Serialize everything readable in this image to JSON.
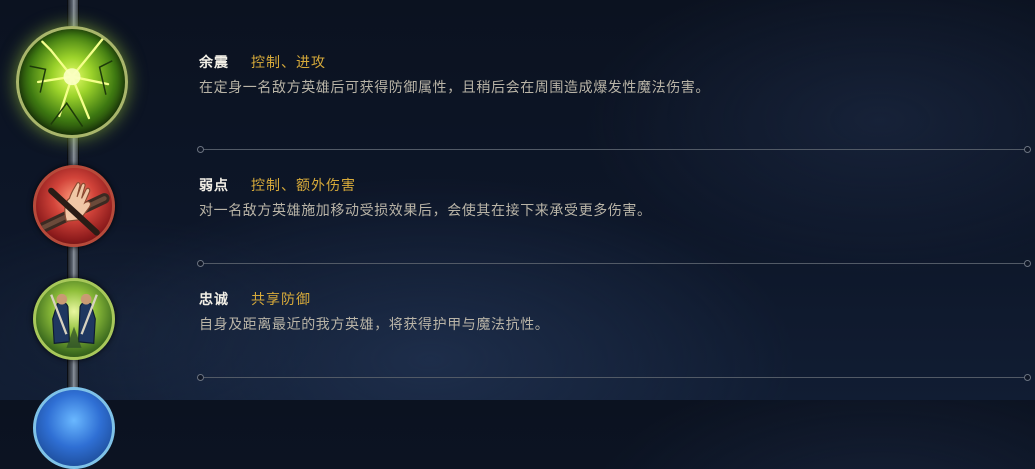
{
  "runes": [
    {
      "name": "余震",
      "tags": "控制、进攻",
      "description": "在定身一名敌方英雄后可获得防御属性，且稍后会在周围造成爆发性魔法伤害。",
      "icon": "aftershock-icon"
    },
    {
      "name": "弱点",
      "tags": "控制、额外伤害",
      "description": "对一名敌方英雄施加移动受损效果后，会使其在接下来承受更多伤害。",
      "icon": "weakness-icon"
    },
    {
      "name": "忠诚",
      "tags": "共享防御",
      "description": "自身及距离最近的我方英雄，将获得护甲与魔法抗性。",
      "icon": "loyalty-icon"
    }
  ],
  "colors": {
    "name": "#f2efe6",
    "tags": "#d7aa3a",
    "description": "#b9b4a7",
    "divider": "#525a66"
  }
}
